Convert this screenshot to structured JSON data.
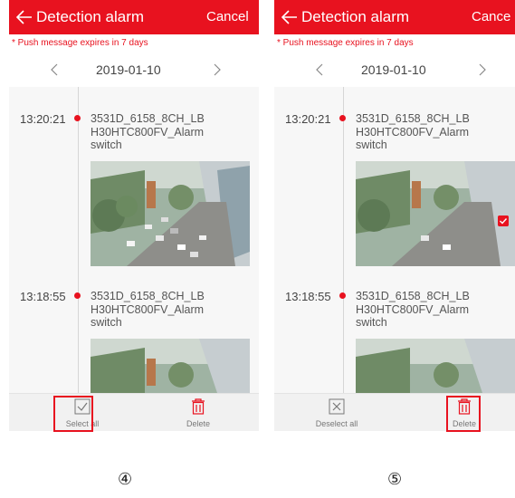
{
  "screens": [
    {
      "header": {
        "title": "Detection alarm",
        "cancel": "Cancel"
      },
      "notice": "* Push message expires in 7 days",
      "date": "2019-01-10",
      "alarms": [
        {
          "time": "13:20:21",
          "device": [
            "3531D_6158_8CH_LB",
            "H30HTC800FV_Alarm",
            "switch"
          ]
        },
        {
          "time": "13:18:55",
          "device": [
            "3531D_6158_8CH_LB",
            "H30HTC800FV_Alarm",
            "switch"
          ]
        }
      ],
      "footer": {
        "left": "Select all",
        "right": "Delete"
      },
      "step": "④"
    },
    {
      "header": {
        "title": "Detection alarm",
        "cancel": "Cance"
      },
      "notice": "* Push message expires in 7 days",
      "date": "2019-01-10",
      "alarms": [
        {
          "time": "13:20:21",
          "device": [
            "3531D_6158_8CH_LB",
            "H30HTC800FV_Alarm",
            "switch"
          ],
          "selected": true
        },
        {
          "time": "13:18:55",
          "device": [
            "3531D_6158_8CH_LB",
            "H30HTC800FV_Alarm",
            "switch"
          ]
        }
      ],
      "footer": {
        "left": "Deselect all",
        "right": "Delete"
      },
      "step": "⑤"
    }
  ],
  "colors": {
    "accent": "#e8121f",
    "footer_bg": "#f1f1f1"
  },
  "icons": [
    "back-arrow-icon",
    "chevron-left-icon",
    "chevron-right-icon",
    "checkbox-checked-icon",
    "checkbox-x-icon",
    "trash-icon"
  ]
}
